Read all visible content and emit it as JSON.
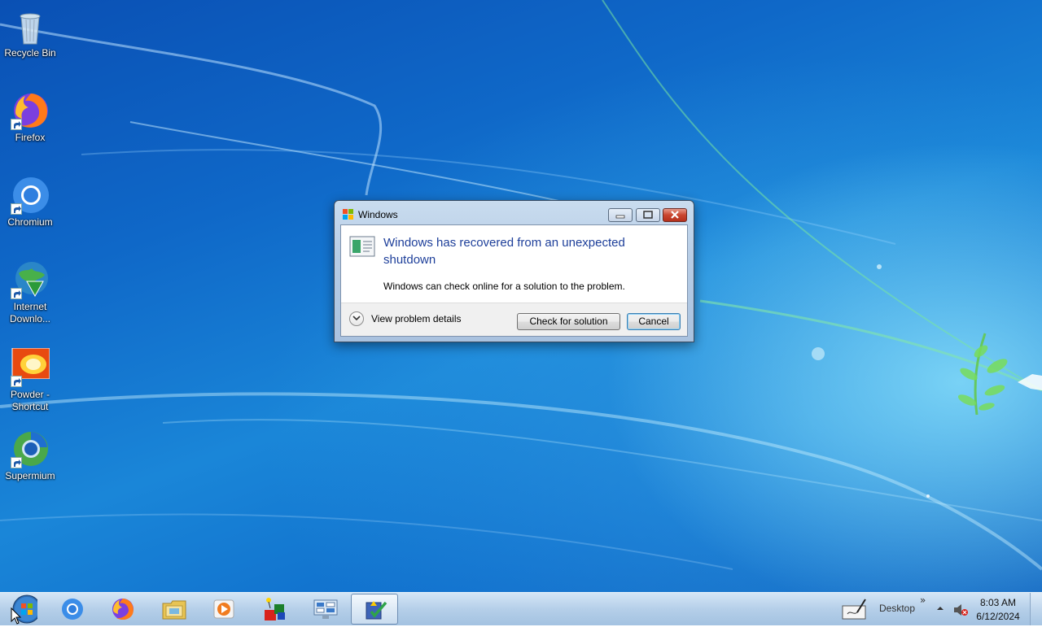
{
  "desktop": {
    "icons": [
      {
        "label": "Recycle Bin",
        "icon": "recycle-bin-icon"
      },
      {
        "label": "Firefox",
        "icon": "firefox-icon"
      },
      {
        "label": "Chromium",
        "icon": "chromium-icon"
      },
      {
        "label": "Internet Downlo...",
        "icon": "internet-download-manager-icon"
      },
      {
        "label": "Powder - Shortcut",
        "icon": "powder-icon"
      },
      {
        "label": "Supermium",
        "icon": "supermium-icon"
      }
    ]
  },
  "dialog": {
    "title": "Windows",
    "heading": "Windows has recovered from an unexpected shutdown",
    "message": "Windows can check online for a solution to the problem.",
    "details_toggle": "View problem details",
    "primary_button": "Check for solution",
    "cancel_button": "Cancel"
  },
  "taskbar": {
    "pinned": [
      {
        "icon": "chromium-icon"
      },
      {
        "icon": "firefox-icon"
      },
      {
        "icon": "file-explorer-icon"
      },
      {
        "icon": "media-player-icon"
      },
      {
        "icon": "app-shapes-icon"
      },
      {
        "icon": "control-panel-icon"
      },
      {
        "icon": "action-center-icon",
        "active": true
      }
    ],
    "tray": {
      "desktop_label": "Desktop",
      "overflow_glyph": "»",
      "time": "8:03 AM",
      "date": "6/12/2024"
    }
  },
  "colors": {
    "dialog_heading": "#1e3f9a",
    "wallpaper_blue": "#0f68c8"
  }
}
